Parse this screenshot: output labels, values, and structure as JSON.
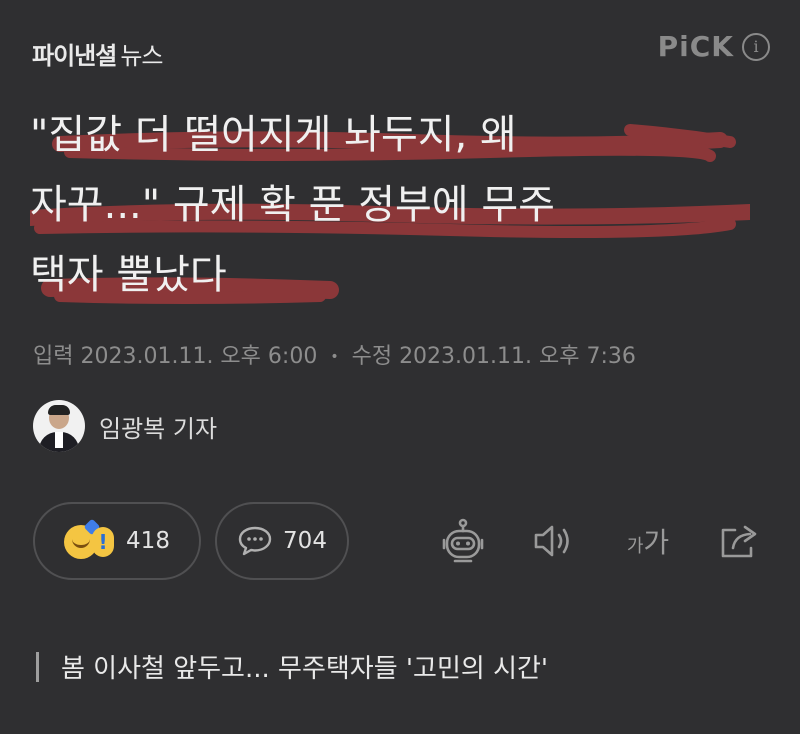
{
  "header": {
    "brand_name": "파이낸셜",
    "brand_suffix": "뉴스",
    "pick_label": "PiCK",
    "info_icon": "i"
  },
  "article": {
    "headline_line1": "\"집값 더 떨어지게 놔두지, 왜",
    "headline_line2": "자꾸...\" 규제 확 푼 정부에 무주",
    "headline_line3": "택자 뿔났다",
    "highlight_color": "#a23a3c",
    "published_label": "입력",
    "published": "2023.01.11. 오후 6:00",
    "modified_label": "수정",
    "modified": "2023.01.11. 오후 7:36",
    "separator": "•"
  },
  "author": {
    "name": "임광복 기자"
  },
  "actions": {
    "reaction_count": "418",
    "comment_count": "704",
    "font_small": "가",
    "font_large": "가",
    "icons": [
      "reaction-emoji-icon",
      "comment-icon",
      "robot-summary-icon",
      "speaker-icon",
      "font-size-icon",
      "share-icon"
    ]
  },
  "related": {
    "title": "봄 이사철 앞두고... 무주택자들 '고민의 시간'"
  }
}
